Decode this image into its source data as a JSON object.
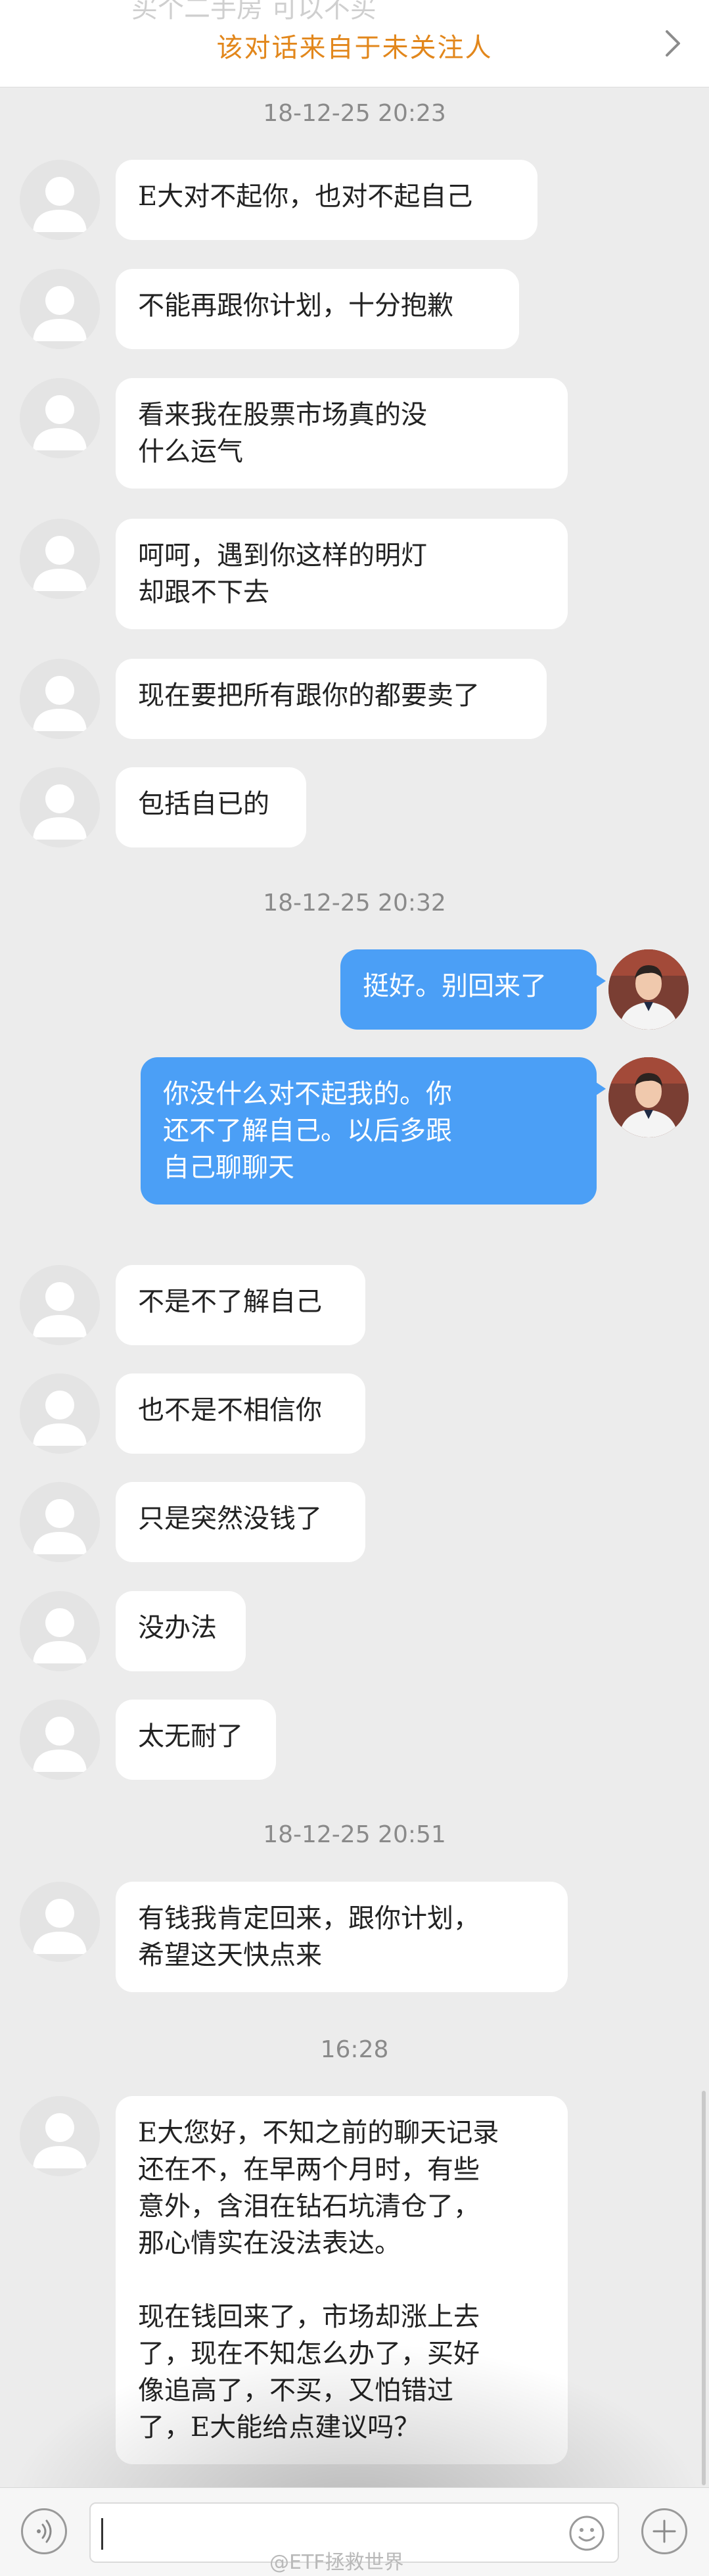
{
  "header": {
    "faded_text": "买个二手房   可以不买",
    "title": "该对话来自于未关注人"
  },
  "timestamps": [
    "18-12-25 20:23",
    "18-12-25 20:32",
    "18-12-25 20:51",
    "16:28"
  ],
  "messages": [
    {
      "side": "left",
      "text": "E大对不起你，也对不起自己"
    },
    {
      "side": "left",
      "text": "不能再跟你计划，十分抱歉"
    },
    {
      "side": "left",
      "text": "看来我在股票市场真的没\n什么运气"
    },
    {
      "side": "left",
      "text": "呵呵，遇到你这样的明灯\n却跟不下去"
    },
    {
      "side": "left",
      "text": "现在要把所有跟你的都要卖了"
    },
    {
      "side": "left",
      "text": "包括自已的"
    },
    {
      "side": "right",
      "text": "挺好。别回来了"
    },
    {
      "side": "right",
      "text": "你没什么对不起我的。你\n还不了解自己。以后多跟\n自己聊聊天"
    },
    {
      "side": "left",
      "text": "不是不了解自己"
    },
    {
      "side": "left",
      "text": "也不是不相信你"
    },
    {
      "side": "left",
      "text": "只是突然没钱了"
    },
    {
      "side": "left",
      "text": "没办法"
    },
    {
      "side": "left",
      "text": "太无耐了"
    },
    {
      "side": "left",
      "text": "有钱我肯定回来，跟你计划，\n希望这天快点来"
    },
    {
      "side": "left",
      "text": "E大您好，不知之前的聊天记录\n还在不，在早两个月时，有些\n意外，含泪在钻石坑清仓了，\n那心情实在没法表达。\n\n现在钱回来了，市场却涨上去\n了，现在不知怎么办了，买好\n像追高了，不买，又怕错过\n了，E大能给点建议吗？"
    }
  ],
  "bottom_bar": {
    "watermark": "@ETF拯救世界"
  },
  "icons": {
    "back": "chevron-right-icon",
    "voice": "voice-icon",
    "emoji": "emoji-icon",
    "plus": "plus-icon"
  },
  "colors": {
    "title": "#e2871c",
    "bubble_right": "#4b9ff6",
    "bubble_left": "#ffffff",
    "background": "#ececec"
  }
}
